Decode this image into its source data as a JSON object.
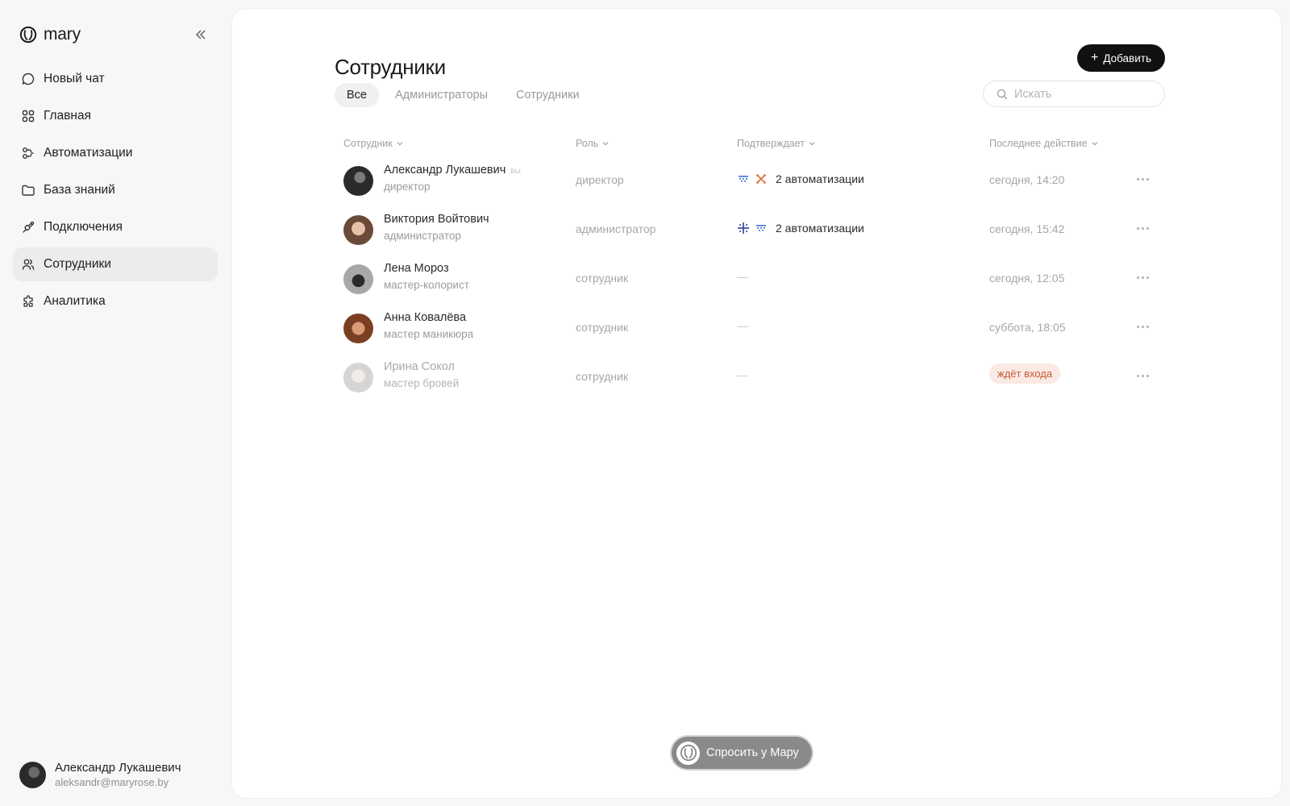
{
  "brand": {
    "name": "mary"
  },
  "sidebar": {
    "items": [
      {
        "label": "Новый чат",
        "icon": "chat-bubble-icon"
      },
      {
        "label": "Главная",
        "icon": "grid-icon"
      },
      {
        "label": "Автоматизации",
        "icon": "automation-icon"
      },
      {
        "label": "База знаний",
        "icon": "folder-icon"
      },
      {
        "label": "Подключения",
        "icon": "plug-icon"
      },
      {
        "label": "Сотрудники",
        "icon": "users-icon",
        "active": true
      },
      {
        "label": "Аналитика",
        "icon": "puzzle-icon"
      }
    ]
  },
  "user": {
    "name": "Александр Лукашевич",
    "email": "aleksandr@maryrose.by"
  },
  "page": {
    "title": "Сотрудники",
    "add_label": "Добавить"
  },
  "tabs": [
    {
      "label": "Все",
      "active": true
    },
    {
      "label": "Администраторы"
    },
    {
      "label": "Сотрудники"
    }
  ],
  "search": {
    "placeholder": "Искать",
    "value": ""
  },
  "table": {
    "headers": {
      "employee": "Сотрудник",
      "role": "Роль",
      "confirms": "Подтверждает",
      "last_action": "Последнее действие"
    },
    "rows": [
      {
        "name": "Александр Лукашевич",
        "you": "вы",
        "title": "директор",
        "role": "директор",
        "confirms": "2 автоматизации",
        "confirm_icons": [
          "calendar-grid-icon",
          "shuffle-x-icon"
        ],
        "last_action": "сегодня, 14:20"
      },
      {
        "name": "Виктория Войтович",
        "title": "администратор",
        "role": "администратор",
        "confirms": "2 автоматизации",
        "confirm_icons": [
          "sparkle-cross-icon",
          "calendar-grid-icon"
        ],
        "last_action": "сегодня, 15:42"
      },
      {
        "name": "Лена Мороз",
        "title": "мастер-колорист",
        "role": "сотрудник",
        "confirms": "—",
        "last_action": "сегодня, 12:05"
      },
      {
        "name": "Анна Ковалёва",
        "title": "мастер маникюра",
        "role": "сотрудник",
        "confirms": "—",
        "last_action": "суббота, 18:05"
      },
      {
        "name": "Ирина Сокол",
        "title": "мастер бровей",
        "role": "сотрудник",
        "confirms": "—",
        "last_action": "ждёт входа",
        "pending": true
      }
    ]
  },
  "ask": {
    "label": "Спросить у Мару"
  },
  "colors": {
    "accent": "#111111",
    "pending_bg": "#fbe9e3",
    "pending_text": "#c65a35",
    "confirm_blue": "#3f6fd6",
    "confirm_orange": "#e0713f"
  }
}
